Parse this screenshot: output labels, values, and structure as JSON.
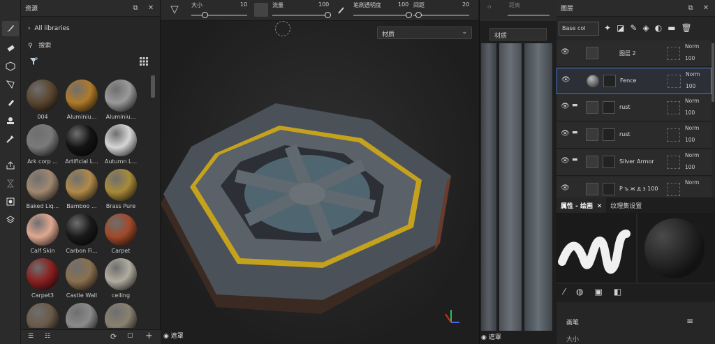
{
  "toolbar": {
    "tools": [
      "paint-brush-icon",
      "eraser-icon",
      "projection-icon",
      "polygon-fill-icon",
      "smudge-icon",
      "clone-stamp-icon",
      "color-picker-icon",
      "bake-icon",
      "geometry-mask-icon",
      "export-icon",
      "display-icon"
    ]
  },
  "assets": {
    "title": "资源",
    "breadcrumb": "All libraries",
    "search_placeholder": "搜索",
    "materials": [
      {
        "name": "004",
        "color": "#5a4630"
      },
      {
        "name": "Aluminiu...",
        "color": "#b07a2a"
      },
      {
        "name": "Aluminiu...",
        "color": "#9a9a9a"
      },
      {
        "name": "Ark corp ...",
        "color": "#7a7a7a"
      },
      {
        "name": "Artificial L...",
        "color": "#141414"
      },
      {
        "name": "Autumn L...",
        "color": "#d6d6d6"
      },
      {
        "name": "Baked Liq...",
        "color": "#a08870"
      },
      {
        "name": "Bamboo ...",
        "color": "#b08a4a"
      },
      {
        "name": "Brass Pure",
        "color": "#a88a3a"
      },
      {
        "name": "Calf Skin",
        "color": "#e0a890"
      },
      {
        "name": "Carbon Fi...",
        "color": "#1a1a1a"
      },
      {
        "name": "Carpet",
        "color": "#a04a2a"
      },
      {
        "name": "Carpet3",
        "color": "#8a2020"
      },
      {
        "name": "Castle Wall",
        "color": "#8a7050"
      },
      {
        "name": "ceiling",
        "color": "#b0aca0"
      },
      {
        "name": "",
        "color": "#6a5a48"
      },
      {
        "name": "",
        "color": "#8a8a8a"
      },
      {
        "name": "",
        "color": "#8a8070"
      }
    ]
  },
  "topbar": {
    "size_label": "大小",
    "size_value": "10",
    "flow_label": "流量",
    "flow_value": "100",
    "opacity_label": "笔刷透明度",
    "opacity_value": "100",
    "spacing_label": "间距",
    "spacing_value": "20",
    "size_frac": 0.25,
    "flow_frac": 1.0,
    "opacity_frac": 1.0,
    "spacing_frac": 0.1
  },
  "viewport": {
    "material_select": "材质",
    "mask_label": "遮罩"
  },
  "uvview": {
    "distance_label": "距离",
    "material_select": "材质",
    "mask_label": "遮罩"
  },
  "layers": {
    "title": "图层",
    "blend_select": "Base col",
    "items": [
      {
        "name": "图层 2",
        "blend": "Norm",
        "opacity": "100",
        "type": "paint"
      },
      {
        "name": "Fence",
        "blend": "Norm",
        "opacity": "100",
        "type": "fill",
        "selected": true
      },
      {
        "name": "rust",
        "blend": "Norm",
        "opacity": "100",
        "type": "folder"
      },
      {
        "name": "rust",
        "blend": "Norm",
        "opacity": "100",
        "type": "folder"
      },
      {
        "name": "Silver Armor",
        "blend": "Norm",
        "opacity": "100",
        "type": "folder"
      },
      {
        "name": "Р ъ ж д з  100",
        "blend": "Norm",
        "opacity": "",
        "type": "fill"
      }
    ]
  },
  "props": {
    "tab1": "属性 - 绘画",
    "tab2": "纹理集设置",
    "section": "画笔",
    "size_label": "大小"
  }
}
